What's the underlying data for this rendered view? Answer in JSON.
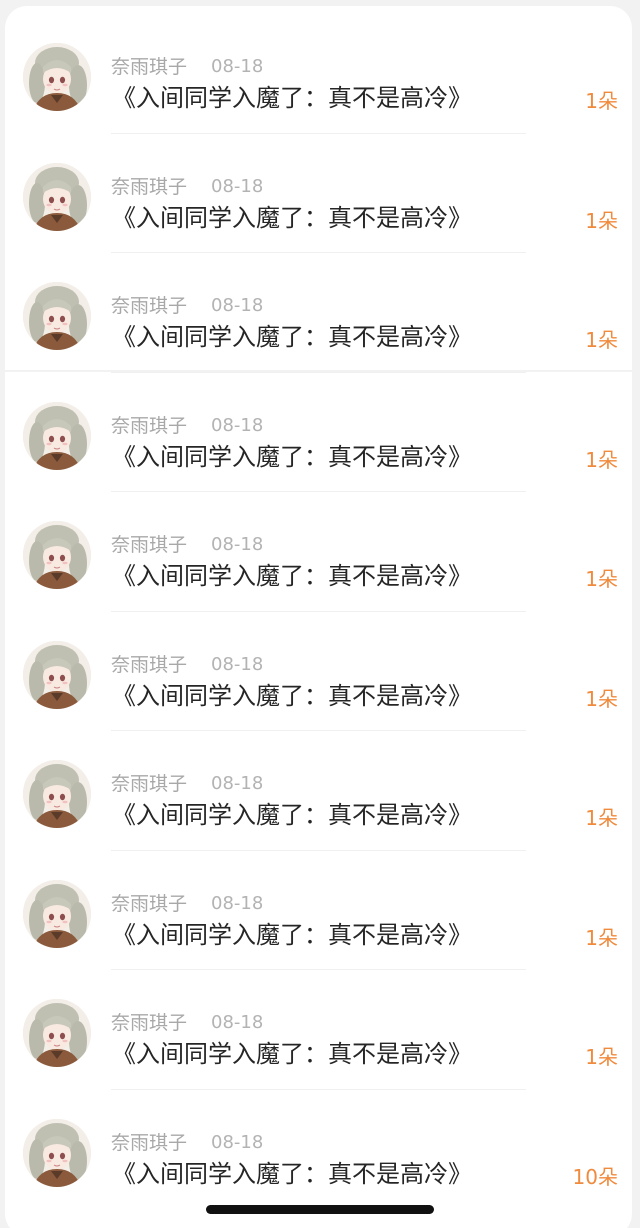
{
  "colors": {
    "page_background": "#f2f2f2",
    "card_background": "#ffffff",
    "name_text": "#a8a8a8",
    "title_text": "#262626",
    "count_accent": "#f08a3c"
  },
  "records": [
    {
      "user_name": "奈雨琪子",
      "date": "08-18",
      "book_title": "《入间同学入魔了：真不是高冷》",
      "gift_count": "1朵",
      "avatar_icon": "anime-girl-avatar-icon"
    },
    {
      "user_name": "奈雨琪子",
      "date": "08-18",
      "book_title": "《入间同学入魔了：真不是高冷》",
      "gift_count": "1朵",
      "avatar_icon": "anime-girl-avatar-icon"
    },
    {
      "user_name": "奈雨琪子",
      "date": "08-18",
      "book_title": "《入间同学入魔了：真不是高冷》",
      "gift_count": "1朵",
      "avatar_icon": "anime-girl-avatar-icon"
    },
    {
      "user_name": "奈雨琪子",
      "date": "08-18",
      "book_title": "《入间同学入魔了：真不是高冷》",
      "gift_count": "1朵",
      "avatar_icon": "anime-girl-avatar-icon"
    },
    {
      "user_name": "奈雨琪子",
      "date": "08-18",
      "book_title": "《入间同学入魔了：真不是高冷》",
      "gift_count": "1朵",
      "avatar_icon": "anime-girl-avatar-icon"
    },
    {
      "user_name": "奈雨琪子",
      "date": "08-18",
      "book_title": "《入间同学入魔了：真不是高冷》",
      "gift_count": "1朵",
      "avatar_icon": "anime-girl-avatar-icon"
    },
    {
      "user_name": "奈雨琪子",
      "date": "08-18",
      "book_title": "《入间同学入魔了：真不是高冷》",
      "gift_count": "1朵",
      "avatar_icon": "anime-girl-avatar-icon"
    },
    {
      "user_name": "奈雨琪子",
      "date": "08-18",
      "book_title": "《入间同学入魔了：真不是高冷》",
      "gift_count": "1朵",
      "avatar_icon": "anime-girl-avatar-icon"
    },
    {
      "user_name": "奈雨琪子",
      "date": "08-18",
      "book_title": "《入间同学入魔了：真不是高冷》",
      "gift_count": "1朵",
      "avatar_icon": "anime-girl-avatar-icon"
    },
    {
      "user_name": "奈雨琪子",
      "date": "08-18",
      "book_title": "《入间同学入魔了：真不是高冷》",
      "gift_count": "10朵",
      "avatar_icon": "anime-girl-avatar-icon"
    }
  ]
}
